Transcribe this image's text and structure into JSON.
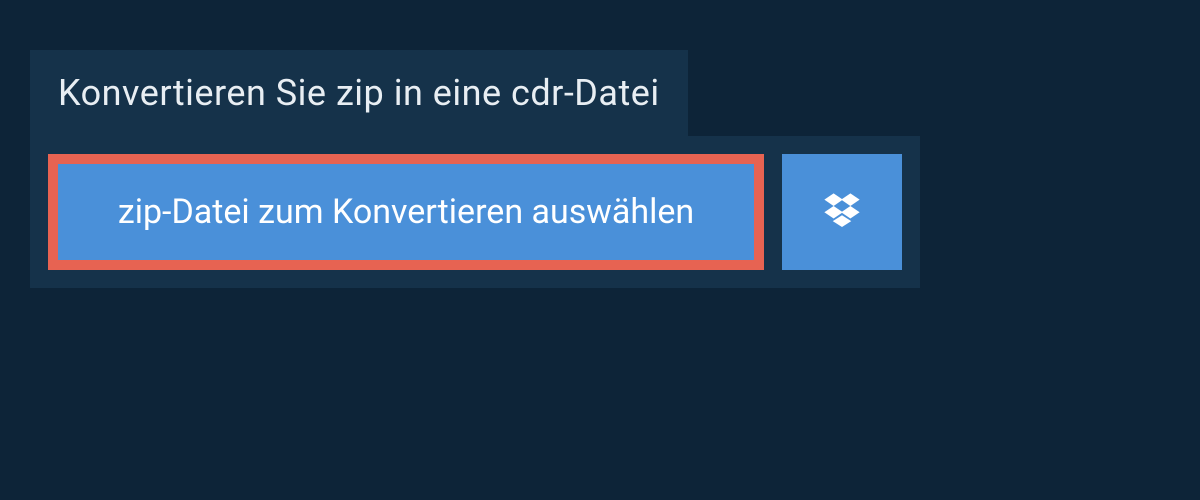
{
  "header": {
    "title": "Konvertieren Sie zip in eine cdr-Datei"
  },
  "actions": {
    "select_file_label": "zip-Datei zum Konvertieren auswählen",
    "dropbox_icon": "dropbox-icon"
  },
  "colors": {
    "background": "#0d2438",
    "panel": "#15324a",
    "button": "#4a90d9",
    "highlight_border": "#e76352",
    "text_light": "#e8eef3"
  }
}
